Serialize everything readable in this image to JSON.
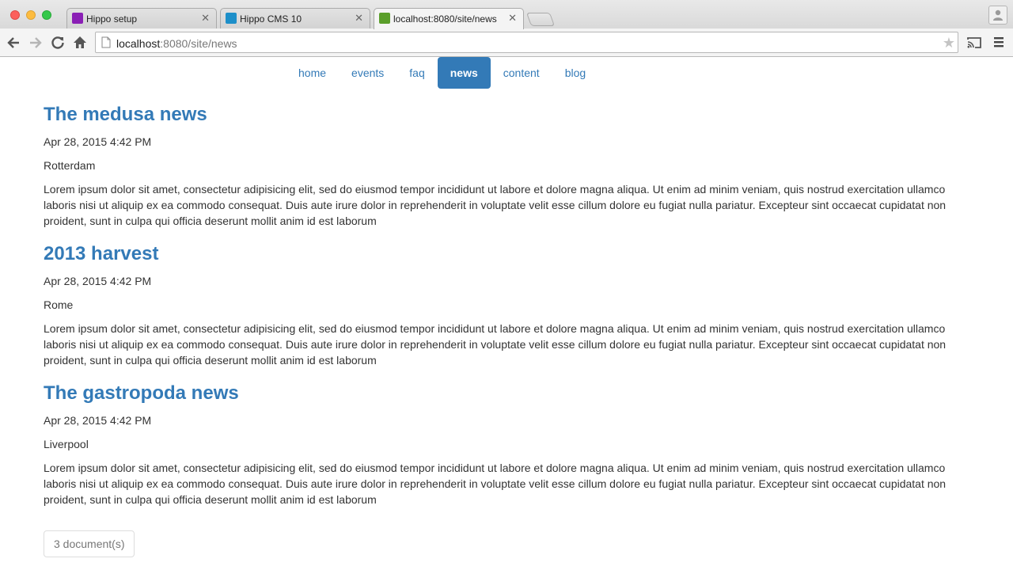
{
  "browser": {
    "tabs": [
      {
        "title": "Hippo setup",
        "favicon_color": "#8a1fb5",
        "active": false
      },
      {
        "title": "Hippo CMS 10",
        "favicon_color": "#1d8fc9",
        "active": false
      },
      {
        "title": "localhost:8080/site/news",
        "favicon_color": "#5a9e2a",
        "active": true
      }
    ],
    "url_host": "localhost",
    "url_rest": ":8080/site/news"
  },
  "nav": {
    "items": [
      {
        "label": "home"
      },
      {
        "label": "events"
      },
      {
        "label": "faq"
      },
      {
        "label": "news"
      },
      {
        "label": "content"
      },
      {
        "label": "blog"
      }
    ],
    "active_index": 3,
    "accent_color": "#337ab7"
  },
  "articles": [
    {
      "title": "The medusa news",
      "date": "Apr 28, 2015 4:42 PM",
      "location": "Rotterdam",
      "body": "Lorem ipsum dolor sit amet, consectetur adipisicing elit, sed do eiusmod tempor incididunt ut labore et dolore magna aliqua. Ut enim ad minim veniam, quis nostrud exercitation ullamco laboris nisi ut aliquip ex ea commodo consequat. Duis aute irure dolor in reprehenderit in voluptate velit esse cillum dolore eu fugiat nulla pariatur. Excepteur sint occaecat cupidatat non proident, sunt in culpa qui officia deserunt mollit anim id est laborum"
    },
    {
      "title": "2013 harvest",
      "date": "Apr 28, 2015 4:42 PM",
      "location": "Rome",
      "body": "Lorem ipsum dolor sit amet, consectetur adipisicing elit, sed do eiusmod tempor incididunt ut labore et dolore magna aliqua. Ut enim ad minim veniam, quis nostrud exercitation ullamco laboris nisi ut aliquip ex ea commodo consequat. Duis aute irure dolor in reprehenderit in voluptate velit esse cillum dolore eu fugiat nulla pariatur. Excepteur sint occaecat cupidatat non proident, sunt in culpa qui officia deserunt mollit anim id est laborum"
    },
    {
      "title": "The gastropoda news",
      "date": "Apr 28, 2015 4:42 PM",
      "location": "Liverpool",
      "body": "Lorem ipsum dolor sit amet, consectetur adipisicing elit, sed do eiusmod tempor incididunt ut labore et dolore magna aliqua. Ut enim ad minim veniam, quis nostrud exercitation ullamco laboris nisi ut aliquip ex ea commodo consequat. Duis aute irure dolor in reprehenderit in voluptate velit esse cillum dolore eu fugiat nulla pariatur. Excepteur sint occaecat cupidatat non proident, sunt in culpa qui officia deserunt mollit anim id est laborum"
    }
  ],
  "document_count": "3 document(s)"
}
